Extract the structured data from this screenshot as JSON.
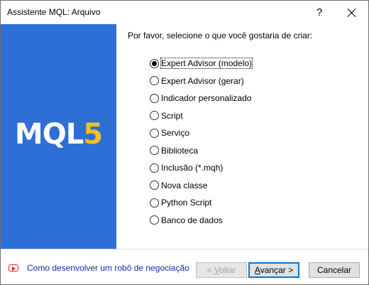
{
  "window": {
    "title": "Assistente MQL: Arquivo",
    "help_glyph": "?"
  },
  "banner": {
    "logo_main": "MQL",
    "logo_number": "5",
    "colors": {
      "background": "#2e6fd6",
      "logo_text": "#ffffff",
      "logo_number": "#f4c21d"
    }
  },
  "prompt": "Por favor, selecione o que você gostaria de criar:",
  "options": [
    {
      "label": "Expert Advisor (modelo)",
      "checked": true
    },
    {
      "label": "Expert Advisor (gerar)",
      "checked": false
    },
    {
      "label": "Indicador personalizado",
      "checked": false
    },
    {
      "label": "Script",
      "checked": false
    },
    {
      "label": "Serviço",
      "checked": false
    },
    {
      "label": "Biblioteca",
      "checked": false
    },
    {
      "label": "Inclusão (*.mqh)",
      "checked": false
    },
    {
      "label": "Nova classe",
      "checked": false
    },
    {
      "label": "Python Script",
      "checked": false
    },
    {
      "label": "Banco de dados",
      "checked": false
    }
  ],
  "footer": {
    "help_link": "Como desenvolver um robô de negociação",
    "help_icon": "youtube-play-icon",
    "back_button": {
      "prefix": "< ",
      "underlined": "V",
      "suffix": "oltar",
      "enabled": false
    },
    "next_button": {
      "prefix": "",
      "underlined": "A",
      "suffix": "vançar >",
      "enabled": true
    },
    "cancel_button": "Cancelar"
  }
}
